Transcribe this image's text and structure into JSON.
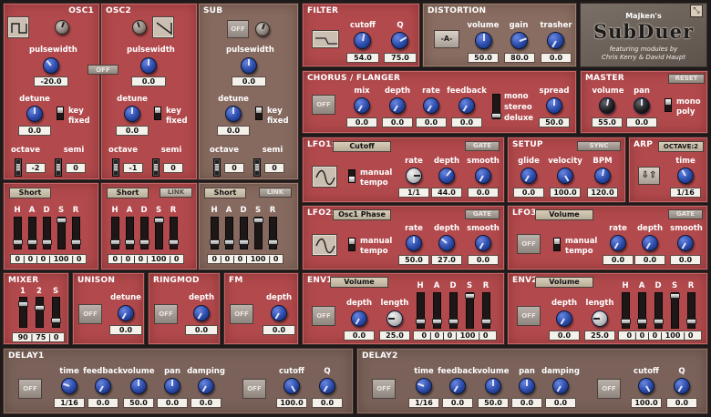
{
  "app": {
    "maker": "Majken's",
    "brand": "SubDuer",
    "featuring": "featuring modules by",
    "credits": "Chris Kerry & David Haupt",
    "corner_icon": "resize-icon"
  },
  "osc1": {
    "title": "OSC1",
    "pulsewidth_label": "pulsewidth",
    "pulsewidth_value": "-20.0",
    "off_label": "OFF",
    "detune_label": "detune",
    "detune_value": "0.0",
    "key_label": "key",
    "fixed_label": "fixed",
    "octave_label": "octave",
    "semi_label": "semi",
    "octave_value": "-2",
    "semi_value": "0"
  },
  "osc2": {
    "title": "OSC2",
    "pulsewidth_label": "pulsewidth",
    "pulsewidth_value": "0.0",
    "detune_label": "detune",
    "detune_value": "0.0",
    "key_label": "key",
    "fixed_label": "fixed",
    "octave_label": "octave",
    "semi_label": "semi",
    "octave_value": "-1",
    "semi_value": "0"
  },
  "sub": {
    "title": "SUB",
    "off_label": "OFF",
    "pulsewidth_label": "pulsewidth",
    "pulsewidth_value": "0.0",
    "detune_label": "detune",
    "detune_value": "0.0",
    "key_label": "key",
    "fixed_label": "fixed",
    "octave_label": "octave",
    "semi_label": "semi",
    "octave_value": "0",
    "semi_value": "0"
  },
  "env_osc1": {
    "preset": "Short",
    "letters": [
      "H",
      "A",
      "D",
      "S",
      "R"
    ],
    "values": "0 | 0 | 0 | 100 | 0"
  },
  "env_osc2": {
    "preset": "Short",
    "link": "LINK",
    "letters": [
      "H",
      "A",
      "D",
      "S",
      "R"
    ],
    "values": "0 | 0 | 0 | 100 | 0"
  },
  "env_sub": {
    "preset": "Short",
    "link": "LINK",
    "letters": [
      "H",
      "A",
      "D",
      "S",
      "R"
    ],
    "values": "0 | 0 | 0 | 100 | 0"
  },
  "filter": {
    "title": "FILTER",
    "cutoff_label": "cutoff",
    "cutoff_value": "54.0",
    "q_label": "Q",
    "q_value": "75.0"
  },
  "distortion": {
    "title": "DISTORTION",
    "mode": "-A-",
    "volume_label": "volume",
    "volume_value": "50.0",
    "gain_label": "gain",
    "gain_value": "80.0",
    "trasher_label": "trasher",
    "trasher_value": "0.0"
  },
  "chorus": {
    "title": "CHORUS / FLANGER",
    "off_label": "OFF",
    "mix_label": "mix",
    "mix_value": "0.0",
    "depth_label": "depth",
    "depth_value": "0.0",
    "rate_label": "rate",
    "rate_value": "0.0",
    "feedback_label": "feedback",
    "feedback_value": "0.0",
    "mono_label": "mono",
    "stereo_label": "stereo",
    "deluxe_label": "deluxe",
    "spread_label": "spread",
    "spread_value": "50.0"
  },
  "master": {
    "title": "MASTER",
    "reset_label": "RESET",
    "volume_label": "volume",
    "volume_value": "55.0",
    "pan_label": "pan",
    "pan_value": "0.0",
    "mono_label": "mono",
    "poly_label": "poly"
  },
  "lfo1": {
    "title": "LFO1:",
    "target": "Cutoff",
    "gate_label": "GATE",
    "manual_label": "manual",
    "tempo_label": "tempo",
    "rate_label": "rate",
    "rate_value": "1/1",
    "depth_label": "depth",
    "depth_value": "44.0",
    "smooth_label": "smooth",
    "smooth_value": "0.0"
  },
  "setup": {
    "title": "SETUP",
    "sync_label": "SYNC",
    "glide_label": "glide",
    "glide_value": "0.0",
    "velocity_label": "velocity",
    "velocity_value": "100.0",
    "bpm_label": "BPM",
    "bpm_value": "120.0"
  },
  "arp": {
    "title": "ARP",
    "octave_label": "OCTAVE:2",
    "time_label": "time",
    "time_value": "1/16",
    "mode_glyph": "⇩⇧"
  },
  "lfo2": {
    "title": "LFO2:",
    "target": "Osc1 Phase",
    "gate_label": "GATE",
    "manual_label": "manual",
    "tempo_label": "tempo",
    "rate_label": "rate",
    "rate_value": "50.0",
    "depth_label": "depth",
    "depth_value": "27.0",
    "smooth_label": "smooth",
    "smooth_value": "0.0"
  },
  "lfo3": {
    "title": "LFO3:",
    "target": "Volume",
    "gate_label": "GATE",
    "off_label": "OFF",
    "manual_label": "manual",
    "tempo_label": "tempo",
    "rate_label": "rate",
    "rate_value": "0.0",
    "depth_label": "depth",
    "depth_value": "0.0",
    "smooth_label": "smooth",
    "smooth_value": "0.0"
  },
  "mixer": {
    "title": "MIXER",
    "labels": [
      "1",
      "2",
      "S"
    ],
    "values": "90 | 75 | 0"
  },
  "unison": {
    "title": "UNISON",
    "off_label": "OFF",
    "detune_label": "detune",
    "detune_value": "0.0"
  },
  "ringmod": {
    "title": "RINGMOD",
    "off_label": "OFF",
    "depth_label": "depth",
    "depth_value": "0.0"
  },
  "fm": {
    "title": "FM",
    "off_label": "OFF",
    "depth_label": "depth",
    "depth_value": "0.0"
  },
  "env1": {
    "title": "ENV1:",
    "target": "Volume",
    "off_label": "OFF",
    "depth_label": "depth",
    "depth_value": "0.0",
    "length_label": "length",
    "length_value": "25.0",
    "letters": [
      "H",
      "A",
      "D",
      "S",
      "R"
    ],
    "values": "0 | 0 | 0 | 100 | 0"
  },
  "env2": {
    "title": "ENV2:",
    "target": "Volume",
    "off_label": "OFF",
    "depth_label": "depth",
    "depth_value": "0.0",
    "length_label": "length",
    "length_value": "25.0",
    "letters": [
      "H",
      "A",
      "D",
      "S",
      "R"
    ],
    "values": "0 | 0 | 0 | 100 | 0"
  },
  "delay1": {
    "title": "DELAY1",
    "off_label": "OFF",
    "off2_label": "OFF",
    "time_label": "time",
    "time_value": "1/16",
    "feedback_label": "feedback",
    "feedback_value": "0.0",
    "volume_label": "volume",
    "volume_value": "50.0",
    "pan_label": "pan",
    "pan_value": "0.0",
    "damping_label": "damping",
    "damping_value": "0.0",
    "cutoff_label": "cutoff",
    "cutoff_value": "100.0",
    "q_label": "Q",
    "q_value": "0.0"
  },
  "delay2": {
    "title": "DELAY2",
    "off_label": "OFF",
    "off2_label": "OFF",
    "time_label": "time",
    "time_value": "1/16",
    "feedback_label": "feedback",
    "feedback_value": "0.0",
    "volume_label": "volume",
    "volume_value": "50.0",
    "pan_label": "pan",
    "pan_value": "0.0",
    "damping_label": "damping",
    "damping_value": "0.0",
    "cutoff_label": "cutoff",
    "cutoff_value": "100.0",
    "q_label": "Q",
    "q_value": "0.0"
  }
}
